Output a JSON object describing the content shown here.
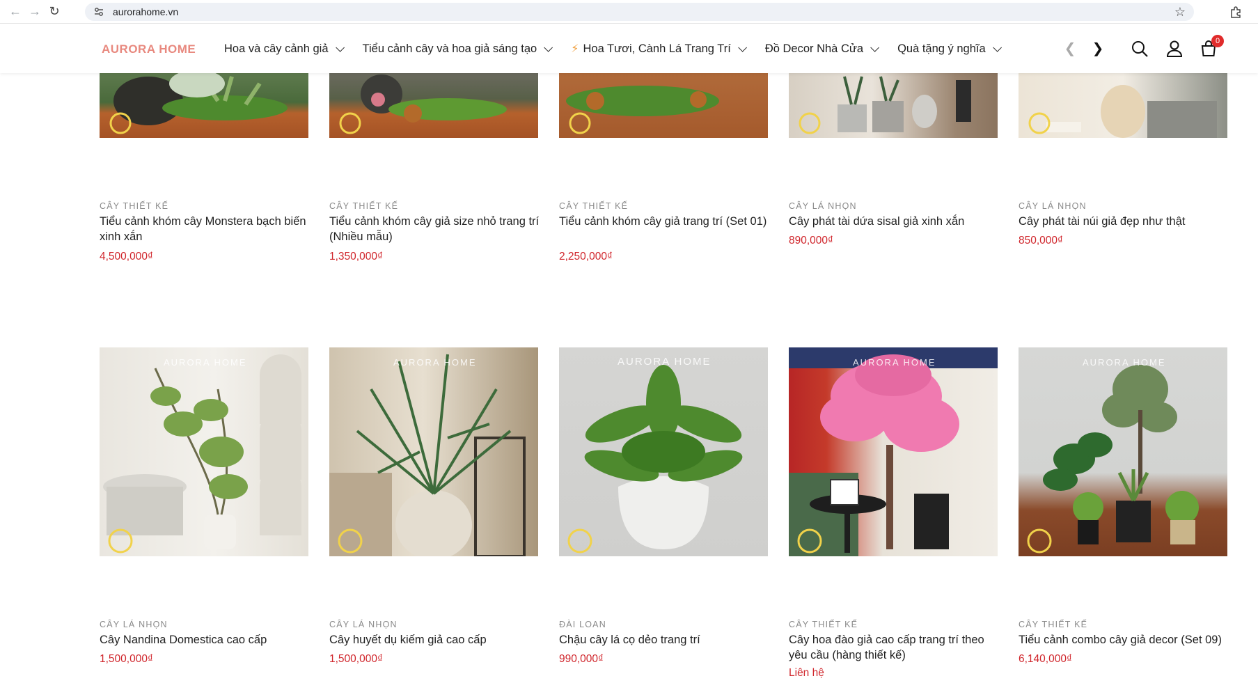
{
  "browser": {
    "url": "aurorahome.vn"
  },
  "header": {
    "logo": "AURORA HOME",
    "menu": [
      {
        "label": "Hoa và cây cảnh giả"
      },
      {
        "label": "Tiểu cảnh cây và hoa giả sáng tạo"
      },
      {
        "label": "Hoa Tươi, Cành Lá Trang Trí"
      },
      {
        "label": "Đồ Decor Nhà Cửa"
      },
      {
        "label": "Quà tặng ý nghĩa"
      }
    ],
    "cart_count": "0"
  },
  "products_row1": [
    {
      "category": "CÂY THIẾT KẾ",
      "name": "Tiểu cảnh khóm cây Monstera bạch biến xinh xắn",
      "price": "4,500,000₫"
    },
    {
      "category": "CÂY THIẾT KẾ",
      "name": "Tiểu cảnh khóm cây giả size nhỏ trang trí (Nhiều mẫu)",
      "price": "1,350,000₫"
    },
    {
      "category": "CÂY THIẾT KẾ",
      "name": "Tiểu cảnh khóm cây giả trang trí (Set 01)",
      "price": "2,250,000₫"
    },
    {
      "category": "CÂY LÁ NHỌN",
      "name": "Cây phát tài dứa sisal giả xinh xắn",
      "price": "890,000₫"
    },
    {
      "category": "CÂY LÁ NHỌN",
      "name": "Cây phát tài núi giả đẹp như thật",
      "price": "850,000₫"
    }
  ],
  "products_row2": [
    {
      "category": "CÂY LÁ NHỌN",
      "name": "Cây Nandina Domestica cao cấp",
      "price": "1,500,000₫",
      "watermark": "AURORA HOME"
    },
    {
      "category": "CÂY LÁ NHỌN",
      "name": "Cây huyết dụ kiếm giả cao cấp",
      "price": "1,500,000₫",
      "watermark": "AURORA HOME"
    },
    {
      "category": "ĐÀI LOAN",
      "name": "Chậu cây lá cọ dẻo trang trí",
      "price": "990,000₫",
      "watermark": "AURORA HOME"
    },
    {
      "category": "CÂY THIẾT KẾ",
      "name": "Cây hoa đào giả cao cấp trang trí theo yêu cầu (hàng thiết kế)",
      "price": "Liên hệ",
      "watermark": "AURORA HOME"
    },
    {
      "category": "CÂY THIẾT KẾ",
      "name": "Tiểu cảnh combo cây giả decor (Set 09)",
      "price": "6,140,000₫",
      "watermark": "AURORA HOME"
    }
  ],
  "colors": {
    "brand": "#e8897f",
    "price": "#d0262c",
    "category": "#8a8a8a"
  }
}
